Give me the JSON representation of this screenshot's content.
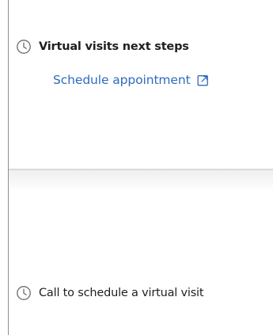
{
  "next_steps": {
    "heading": "Virtual visits next steps",
    "heading_icon": "clock-icon",
    "link_label": "Schedule appointment",
    "link_icon": "external-link-icon",
    "link_color": "#2f6bbd"
  },
  "call_section": {
    "label": "Call to schedule a virtual visit",
    "icon": "clock-icon"
  }
}
